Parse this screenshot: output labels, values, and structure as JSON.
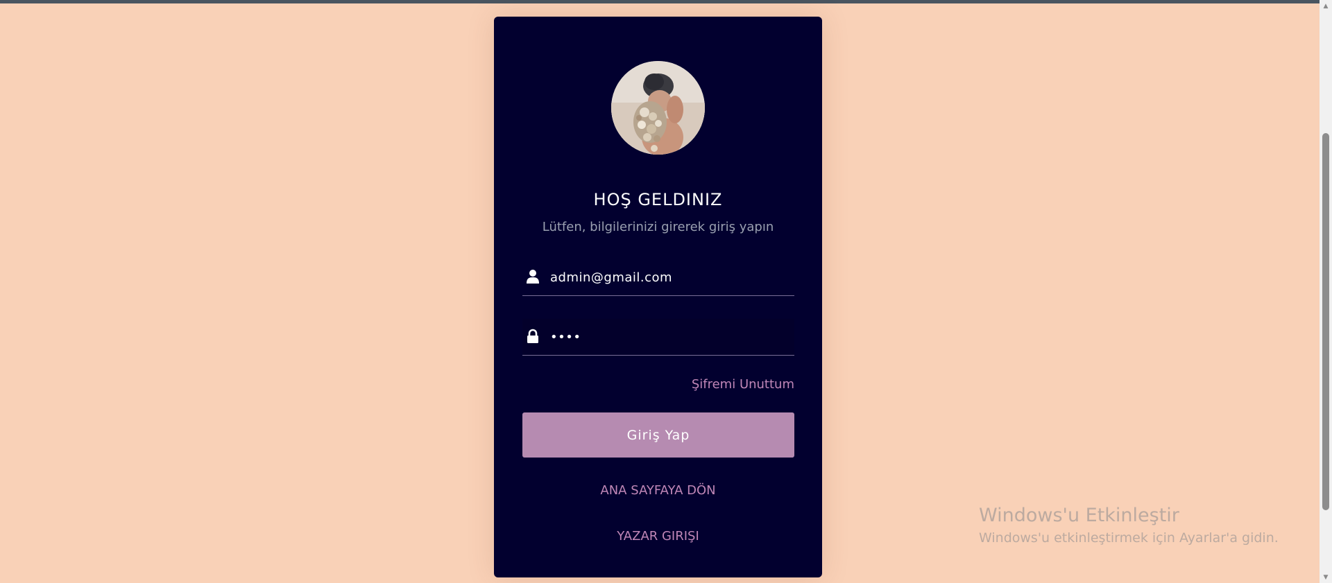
{
  "login": {
    "title": "HOŞ GELDINIZ",
    "subtitle": "Lütfen, bilgilerinizi girerek giriş yapın",
    "email_value": "admin@gmail.com",
    "password_value": "••••",
    "forgot_link": "Şifremi Unuttum",
    "submit_label": "Giriş Yap",
    "home_link": "ANA SAYFAYA DÖN",
    "author_link": "YAZAR GIRIŞI"
  },
  "icons": {
    "user": "user-icon",
    "lock": "lock-icon",
    "avatar": "profile-photo"
  },
  "watermark": {
    "title": "Windows'u Etkinleştir",
    "subtitle": "Windows'u etkinleştirmek için Ayarlar'a gidin."
  },
  "colors": {
    "background": "#f9d1b7",
    "card": "#02002f",
    "accent": "#b68bb1",
    "link": "#c087b7"
  }
}
